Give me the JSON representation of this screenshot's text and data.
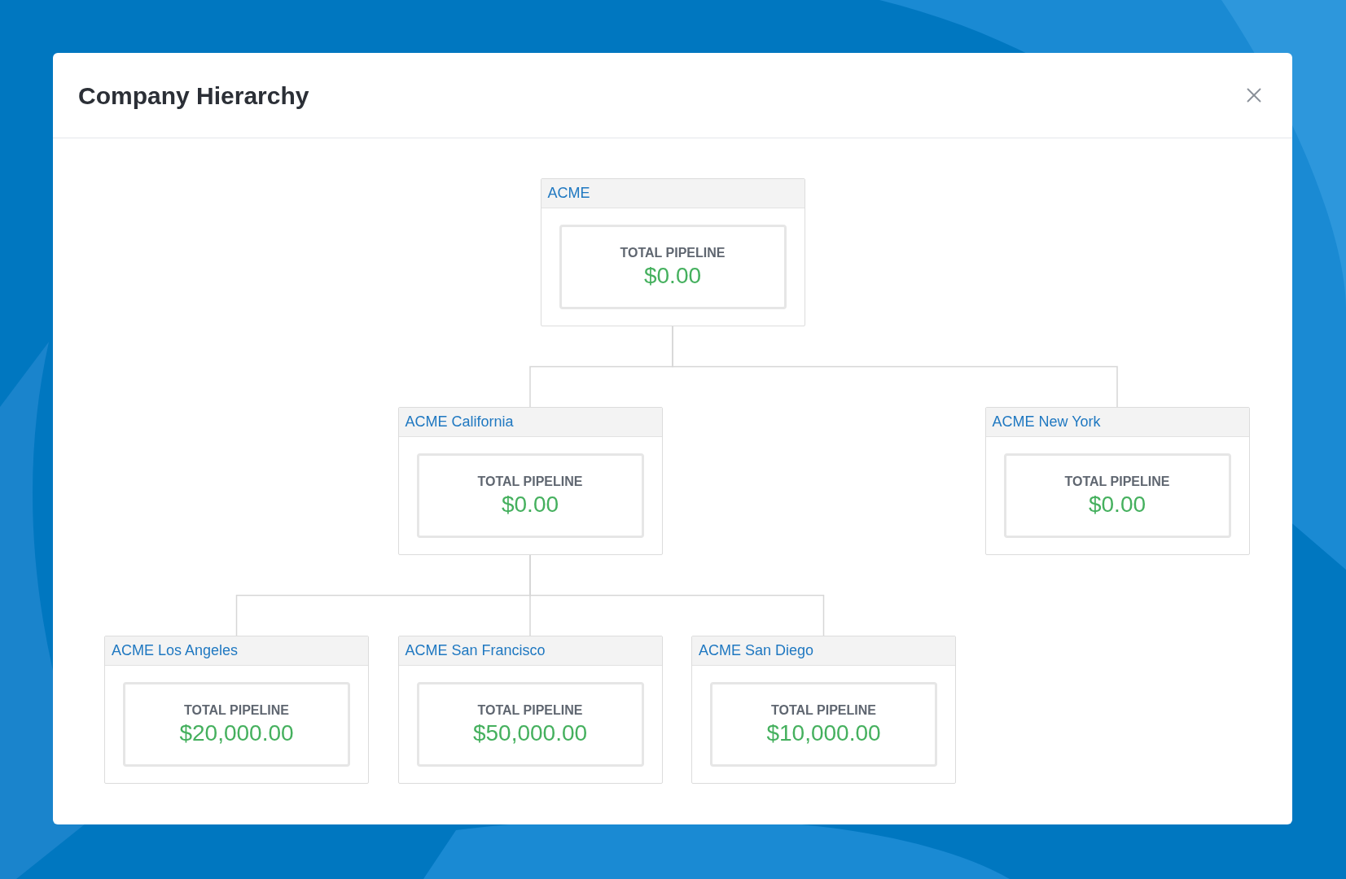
{
  "dialog": {
    "title": "Company Hierarchy"
  },
  "hierarchy": {
    "name": "ACME",
    "metric_label": "TOTAL PIPELINE",
    "metric_value": "$0.00",
    "children": [
      {
        "name": "ACME California",
        "metric_label": "TOTAL PIPELINE",
        "metric_value": "$0.00",
        "children": [
          {
            "name": "ACME Los Angeles",
            "metric_label": "TOTAL PIPELINE",
            "metric_value": "$20,000.00"
          },
          {
            "name": "ACME San Francisco",
            "metric_label": "TOTAL PIPELINE",
            "metric_value": "$50,000.00"
          },
          {
            "name": "ACME San Diego",
            "metric_label": "TOTAL PIPELINE",
            "metric_value": "$10,000.00"
          }
        ]
      },
      {
        "name": "ACME New York",
        "metric_label": "TOTAL PIPELINE",
        "metric_value": "$0.00"
      }
    ]
  }
}
